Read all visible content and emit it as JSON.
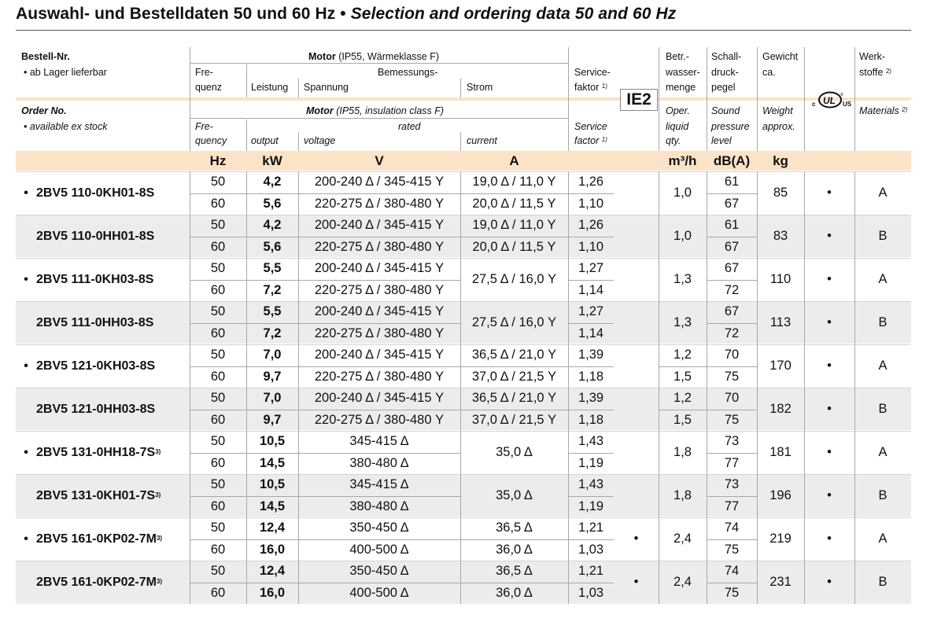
{
  "title": {
    "de": "Auswahl- und Bestelldaten 50 und 60 Hz",
    "sep": " • ",
    "en": "Selection and ordering data 50 and 60 Hz"
  },
  "header_de": {
    "order_no": "Bestell-Nr.",
    "stock": "•  ab Lager lieferbar",
    "motor": "Motor",
    "motor_note": " (IP55, Wärmeklasse F)",
    "freq1": "Fre-",
    "freq2": "quenz",
    "rated": "Bemessungs-",
    "power": "Leistung",
    "voltage": "Spannung",
    "current": "Strom",
    "service1": "Service-",
    "service2": "faktor",
    "service_sup": "1)",
    "water1": "Betr.-",
    "water2": "wasser-",
    "water3": "menge",
    "sound1": "Schall-",
    "sound2": "druck-",
    "sound3": "pegel",
    "weight1": "Gewicht",
    "weight2": "ca.",
    "mat1": "Werk-",
    "mat2": "stoffe",
    "mat_sup": "2)"
  },
  "header_en": {
    "order_no": "Order No.",
    "stock": "•  available ex stock",
    "motor": "Motor",
    "motor_note": " (IP55, insulation class F)",
    "freq1": "Fre-",
    "freq2": "quency",
    "rated": "rated",
    "power": "output",
    "voltage": "voltage",
    "current": "current",
    "service1": "Service",
    "service2": "factor",
    "service_sup": "1)",
    "water1": "Oper.",
    "water2": "liquid",
    "water3": "qty.",
    "sound1": "Sound",
    "sound2": "pressure",
    "sound3": "level",
    "weight1": "Weight",
    "weight2": "approx.",
    "mat1": "Materials",
    "mat_sup": "2)"
  },
  "ie2_label": "IE2",
  "ul_mark": {
    "c": "c",
    "ul": "UL",
    "us": "US",
    "r": "®"
  },
  "units": {
    "freq": "Hz",
    "power": "kW",
    "voltage": "V",
    "current": "A",
    "water": "m³/h",
    "sound": "dB(A)",
    "weight": "kg"
  },
  "rows": [
    {
      "stock": true,
      "order_no": "2BV5 110-0KH01-8S",
      "sup": "",
      "ie2": "",
      "ul": "•",
      "weight": "85",
      "material": "A",
      "water_merged": "1,0",
      "current_merged": "",
      "sub": [
        {
          "freq": "50",
          "power": "4,2",
          "voltage": "200-240 Δ / 345-415 Y",
          "current": "19,0 Δ / 11,0 Y",
          "sf": "1,26",
          "water": "",
          "sound": "61"
        },
        {
          "freq": "60",
          "power": "5,6",
          "voltage": "220-275 Δ / 380-480 Y",
          "current": "20,0 Δ / 11,5 Y",
          "sf": "1,10",
          "water": "",
          "sound": "67"
        }
      ]
    },
    {
      "stock": false,
      "order_no": "2BV5 110-0HH01-8S",
      "sup": "",
      "ie2": "",
      "ul": "•",
      "weight": "83",
      "material": "B",
      "water_merged": "1,0",
      "current_merged": "",
      "sub": [
        {
          "freq": "50",
          "power": "4,2",
          "voltage": "200-240 Δ / 345-415 Y",
          "current": "19,0 Δ / 11,0 Y",
          "sf": "1,26",
          "water": "",
          "sound": "61"
        },
        {
          "freq": "60",
          "power": "5,6",
          "voltage": "220-275 Δ / 380-480 Y",
          "current": "20,0 Δ / 11,5 Y",
          "sf": "1,10",
          "water": "",
          "sound": "67"
        }
      ]
    },
    {
      "stock": true,
      "order_no": "2BV5 111-0KH03-8S",
      "sup": "",
      "ie2": "",
      "ul": "•",
      "weight": "110",
      "material": "A",
      "water_merged": "1,3",
      "current_merged": "27,5 Δ / 16,0 Y",
      "sub": [
        {
          "freq": "50",
          "power": "5,5",
          "voltage": "200-240 Δ / 345-415 Y",
          "current": "",
          "sf": "1,27",
          "water": "",
          "sound": "67"
        },
        {
          "freq": "60",
          "power": "7,2",
          "voltage": "220-275 Δ / 380-480 Y",
          "current": "",
          "sf": "1,14",
          "water": "",
          "sound": "72"
        }
      ]
    },
    {
      "stock": false,
      "order_no": "2BV5 111-0HH03-8S",
      "sup": "",
      "ie2": "",
      "ul": "•",
      "weight": "113",
      "material": "B",
      "water_merged": "1,3",
      "current_merged": "27,5 Δ / 16,0 Y",
      "sub": [
        {
          "freq": "50",
          "power": "5,5",
          "voltage": "200-240 Δ / 345-415 Y",
          "current": "",
          "sf": "1,27",
          "water": "",
          "sound": "67"
        },
        {
          "freq": "60",
          "power": "7,2",
          "voltage": "220-275 Δ / 380-480 Y",
          "current": "",
          "sf": "1,14",
          "water": "",
          "sound": "72"
        }
      ]
    },
    {
      "stock": true,
      "order_no": "2BV5 121-0KH03-8S",
      "sup": "",
      "ie2": "",
      "ul": "•",
      "weight": "170",
      "material": "A",
      "water_merged": "",
      "current_merged": "",
      "sub": [
        {
          "freq": "50",
          "power": "7,0",
          "voltage": "200-240 Δ / 345-415 Y",
          "current": "36,5 Δ / 21,0 Y",
          "sf": "1,39",
          "water": "1,2",
          "sound": "70"
        },
        {
          "freq": "60",
          "power": "9,7",
          "voltage": "220-275 Δ / 380-480 Y",
          "current": "37,0 Δ / 21,5 Y",
          "sf": "1,18",
          "water": "1,5",
          "sound": "75"
        }
      ]
    },
    {
      "stock": false,
      "order_no": "2BV5 121-0HH03-8S",
      "sup": "",
      "ie2": "",
      "ul": "•",
      "weight": "182",
      "material": "B",
      "water_merged": "",
      "current_merged": "",
      "sub": [
        {
          "freq": "50",
          "power": "7,0",
          "voltage": "200-240 Δ / 345-415 Y",
          "current": "36,5 Δ / 21,0 Y",
          "sf": "1,39",
          "water": "1,2",
          "sound": "70"
        },
        {
          "freq": "60",
          "power": "9,7",
          "voltage": "220-275 Δ / 380-480 Y",
          "current": "37,0 Δ / 21,5 Y",
          "sf": "1,18",
          "water": "1,5",
          "sound": "75"
        }
      ]
    },
    {
      "stock": true,
      "order_no": "2BV5 131-0HH18-7S",
      "sup": "3)",
      "ie2": "",
      "ul": "•",
      "weight": "181",
      "material": "A",
      "water_merged": "1,8",
      "current_merged": "35,0 Δ",
      "sub": [
        {
          "freq": "50",
          "power": "10,5",
          "voltage": "345-415 Δ",
          "current": "",
          "sf": "1,43",
          "water": "",
          "sound": "73"
        },
        {
          "freq": "60",
          "power": "14,5",
          "voltage": "380-480 Δ",
          "current": "",
          "sf": "1,19",
          "water": "",
          "sound": "77"
        }
      ]
    },
    {
      "stock": false,
      "order_no": "2BV5 131-0KH01-7S",
      "sup": "3)",
      "ie2": "",
      "ul": "•",
      "weight": "196",
      "material": "B",
      "water_merged": "1,8",
      "current_merged": "35,0 Δ",
      "sub": [
        {
          "freq": "50",
          "power": "10,5",
          "voltage": "345-415 Δ",
          "current": "",
          "sf": "1,43",
          "water": "",
          "sound": "73"
        },
        {
          "freq": "60",
          "power": "14,5",
          "voltage": "380-480 Δ",
          "current": "",
          "sf": "1,19",
          "water": "",
          "sound": "77"
        }
      ]
    },
    {
      "stock": true,
      "order_no": "2BV5 161-0KP02-7M",
      "sup": "3)",
      "ie2": "•",
      "ul": "•",
      "weight": "219",
      "material": "A",
      "water_merged": "2,4",
      "current_merged": "",
      "sub": [
        {
          "freq": "50",
          "power": "12,4",
          "voltage": "350-450 Δ",
          "current": "36,5 Δ",
          "sf": "1,21",
          "water": "",
          "sound": "74"
        },
        {
          "freq": "60",
          "power": "16,0",
          "voltage": "400-500 Δ",
          "current": "36,0 Δ",
          "sf": "1,03",
          "water": "",
          "sound": "75"
        }
      ]
    },
    {
      "stock": false,
      "order_no": "2BV5 161-0KP02-7M",
      "sup": "3)",
      "ie2": "•",
      "ul": "•",
      "weight": "231",
      "material": "B",
      "water_merged": "2,4",
      "current_merged": "",
      "sub": [
        {
          "freq": "50",
          "power": "12,4",
          "voltage": "350-450 Δ",
          "current": "36,5 Δ",
          "sf": "1,21",
          "water": "",
          "sound": "74"
        },
        {
          "freq": "60",
          "power": "16,0",
          "voltage": "400-500 Δ",
          "current": "36,0 Δ",
          "sf": "1,03",
          "water": "",
          "sound": "75"
        }
      ]
    }
  ]
}
